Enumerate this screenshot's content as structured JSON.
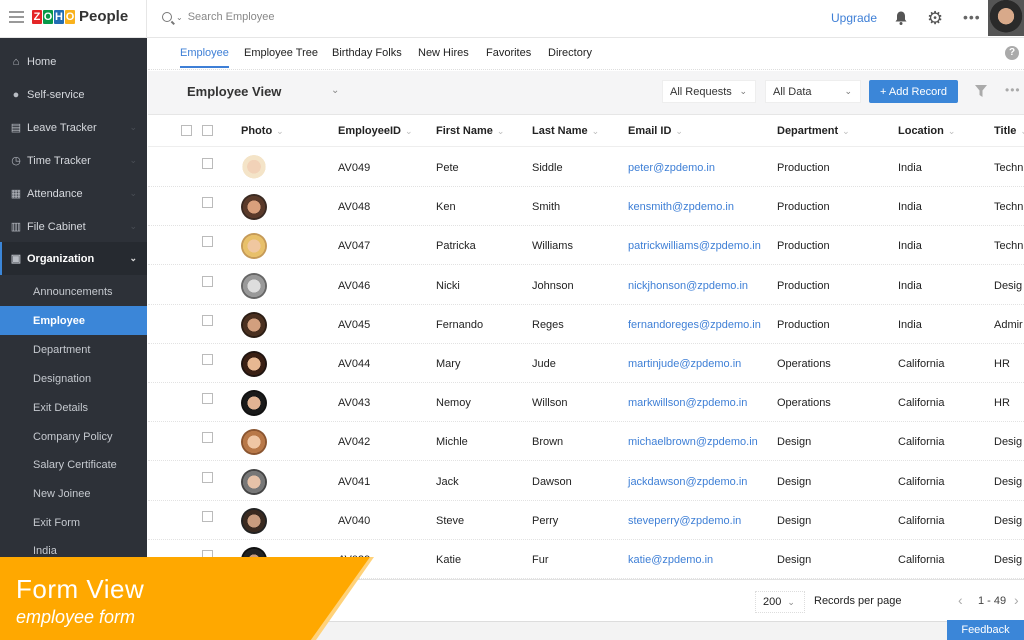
{
  "app": {
    "brand_letters": [
      "Z",
      "O",
      "H",
      "O"
    ],
    "brand_colors": [
      "#e42527",
      "#089949",
      "#226db4",
      "#f9b21d"
    ],
    "product": "People",
    "search_placeholder": "Search Employee",
    "upgrade_label": "Upgrade",
    "accent": "#3b86d8"
  },
  "sidebar": {
    "items": [
      {
        "label": "Home",
        "icon": "home-icon",
        "glyph": "⌂"
      },
      {
        "label": "Self-service",
        "icon": "user-icon",
        "glyph": "👤"
      },
      {
        "label": "Leave Tracker",
        "icon": "leave-icon",
        "glyph": "▤"
      },
      {
        "label": "Time Tracker",
        "icon": "clock-icon",
        "glyph": "◷"
      },
      {
        "label": "Attendance",
        "icon": "calendar-icon",
        "glyph": "▦"
      },
      {
        "label": "File Cabinet",
        "icon": "file-icon",
        "glyph": "▥"
      },
      {
        "label": "Organization",
        "icon": "organization-icon",
        "glyph": "▣"
      }
    ],
    "sub_items": [
      "Announcements",
      "Employee",
      "Department",
      "Designation",
      "Exit Details",
      "Company Policy",
      "Salary Certificate",
      "New Joinee",
      "Exit Form",
      "India"
    ],
    "active_sub": "Employee"
  },
  "tabs": [
    "Employee",
    "Employee Tree",
    "Birthday Folks",
    "New Hires",
    "Favorites",
    "Directory"
  ],
  "active_tab": "Employee",
  "viewbar": {
    "view_name": "Employee View",
    "requests_filter": "All Requests",
    "data_filter": "All Data",
    "add_label": "+ Add Record"
  },
  "table": {
    "columns": [
      "Photo",
      "EmployeeID",
      "First Name",
      "Last Name",
      "Email ID",
      "Department",
      "Location",
      "Title"
    ],
    "rows": [
      {
        "id": "AV049",
        "first": "Pete",
        "last": "Siddle",
        "email": "peter@zpdemo.in",
        "dept": "Production",
        "loc": "India",
        "title": "Techn"
      },
      {
        "id": "AV048",
        "first": "Ken",
        "last": "Smith",
        "email": "kensmith@zpdemo.in",
        "dept": "Production",
        "loc": "India",
        "title": "Techn"
      },
      {
        "id": "AV047",
        "first": "Patricka",
        "last": "Williams",
        "email": "patrickwilliams@zpdemo.in",
        "dept": "Production",
        "loc": "India",
        "title": "Techn"
      },
      {
        "id": "AV046",
        "first": "Nicki",
        "last": "Johnson",
        "email": "nickjhonson@zpdemo.in",
        "dept": "Production",
        "loc": "India",
        "title": "Desig"
      },
      {
        "id": "AV045",
        "first": "Fernando",
        "last": "Reges",
        "email": "fernandoreges@zpdemo.in",
        "dept": "Production",
        "loc": "India",
        "title": "Admir"
      },
      {
        "id": "AV044",
        "first": "Mary",
        "last": "Jude",
        "email": "martinjude@zpdemo.in",
        "dept": "Operations",
        "loc": "California",
        "title": "HR"
      },
      {
        "id": "AV043",
        "first": "Nemoy",
        "last": "Willson",
        "email": "markwillson@zpdemo.in",
        "dept": "Operations",
        "loc": "California",
        "title": "HR"
      },
      {
        "id": "AV042",
        "first": "Michle",
        "last": "Brown",
        "email": "michaelbrown@zpdemo.in",
        "dept": "Design",
        "loc": "California",
        "title": "Desig"
      },
      {
        "id": "AV041",
        "first": "Jack",
        "last": "Dawson",
        "email": "jackdawson@zpdemo.in",
        "dept": "Design",
        "loc": "California",
        "title": "Desig"
      },
      {
        "id": "AV040",
        "first": "Steve",
        "last": "Perry",
        "email": "steveperry@zpdemo.in",
        "dept": "Design",
        "loc": "California",
        "title": "Desig"
      },
      {
        "id": "AV039",
        "first": "Katie",
        "last": "Fur",
        "email": "katie@zpdemo.in",
        "dept": "Design",
        "loc": "California",
        "title": "Desig"
      }
    ]
  },
  "footer": {
    "per_page": "200",
    "per_page_label": "Records per page",
    "range": "1 - 49",
    "feedback_label": "Feedback"
  },
  "banner": {
    "title": "Form View",
    "subtitle": "employee form",
    "color": "#ffa800"
  }
}
